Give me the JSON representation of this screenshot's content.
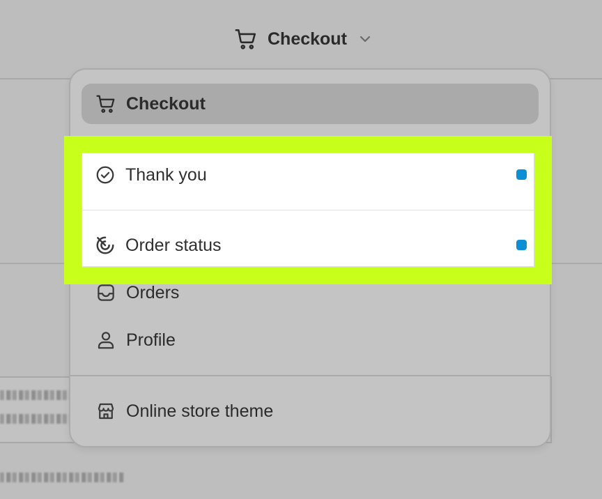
{
  "header": {
    "page_selector_label": "Checkout"
  },
  "menu": {
    "selected": {
      "label": "Checkout",
      "icon": "cart-icon"
    },
    "highlighted_items": [
      {
        "label": "Thank you",
        "icon": "check-circle-icon",
        "status_color": "#0d8fd6"
      },
      {
        "label": "Order status",
        "icon": "order-status-icon",
        "status_color": "#0d8fd6"
      }
    ],
    "items": [
      {
        "label": "Orders",
        "icon": "inbox-icon"
      },
      {
        "label": "Profile",
        "icon": "person-icon"
      }
    ],
    "footer_item": {
      "label": "Online store theme",
      "icon": "store-icon"
    }
  },
  "colors": {
    "highlight": "#c8ff1b",
    "status_dot": "#0d8fd6",
    "backdrop": "#bebebe"
  }
}
